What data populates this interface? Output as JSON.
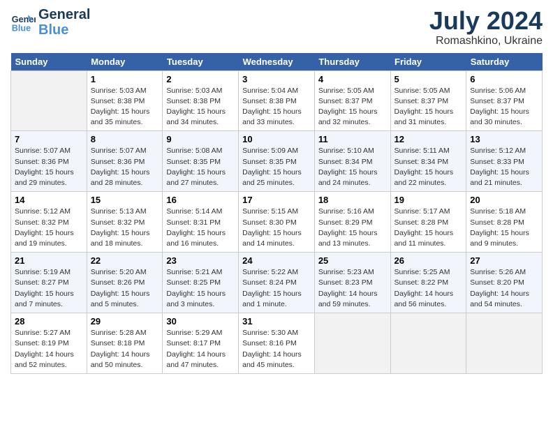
{
  "header": {
    "logo_line1": "General",
    "logo_line2": "Blue",
    "month_year": "July 2024",
    "location": "Romashkino, Ukraine"
  },
  "days_of_week": [
    "Sunday",
    "Monday",
    "Tuesday",
    "Wednesday",
    "Thursday",
    "Friday",
    "Saturday"
  ],
  "weeks": [
    [
      {
        "day": "",
        "info": ""
      },
      {
        "day": "1",
        "info": "Sunrise: 5:03 AM\nSunset: 8:38 PM\nDaylight: 15 hours\nand 35 minutes."
      },
      {
        "day": "2",
        "info": "Sunrise: 5:03 AM\nSunset: 8:38 PM\nDaylight: 15 hours\nand 34 minutes."
      },
      {
        "day": "3",
        "info": "Sunrise: 5:04 AM\nSunset: 8:38 PM\nDaylight: 15 hours\nand 33 minutes."
      },
      {
        "day": "4",
        "info": "Sunrise: 5:05 AM\nSunset: 8:37 PM\nDaylight: 15 hours\nand 32 minutes."
      },
      {
        "day": "5",
        "info": "Sunrise: 5:05 AM\nSunset: 8:37 PM\nDaylight: 15 hours\nand 31 minutes."
      },
      {
        "day": "6",
        "info": "Sunrise: 5:06 AM\nSunset: 8:37 PM\nDaylight: 15 hours\nand 30 minutes."
      }
    ],
    [
      {
        "day": "7",
        "info": "Sunrise: 5:07 AM\nSunset: 8:36 PM\nDaylight: 15 hours\nand 29 minutes."
      },
      {
        "day": "8",
        "info": "Sunrise: 5:07 AM\nSunset: 8:36 PM\nDaylight: 15 hours\nand 28 minutes."
      },
      {
        "day": "9",
        "info": "Sunrise: 5:08 AM\nSunset: 8:35 PM\nDaylight: 15 hours\nand 27 minutes."
      },
      {
        "day": "10",
        "info": "Sunrise: 5:09 AM\nSunset: 8:35 PM\nDaylight: 15 hours\nand 25 minutes."
      },
      {
        "day": "11",
        "info": "Sunrise: 5:10 AM\nSunset: 8:34 PM\nDaylight: 15 hours\nand 24 minutes."
      },
      {
        "day": "12",
        "info": "Sunrise: 5:11 AM\nSunset: 8:34 PM\nDaylight: 15 hours\nand 22 minutes."
      },
      {
        "day": "13",
        "info": "Sunrise: 5:12 AM\nSunset: 8:33 PM\nDaylight: 15 hours\nand 21 minutes."
      }
    ],
    [
      {
        "day": "14",
        "info": "Sunrise: 5:12 AM\nSunset: 8:32 PM\nDaylight: 15 hours\nand 19 minutes."
      },
      {
        "day": "15",
        "info": "Sunrise: 5:13 AM\nSunset: 8:32 PM\nDaylight: 15 hours\nand 18 minutes."
      },
      {
        "day": "16",
        "info": "Sunrise: 5:14 AM\nSunset: 8:31 PM\nDaylight: 15 hours\nand 16 minutes."
      },
      {
        "day": "17",
        "info": "Sunrise: 5:15 AM\nSunset: 8:30 PM\nDaylight: 15 hours\nand 14 minutes."
      },
      {
        "day": "18",
        "info": "Sunrise: 5:16 AM\nSunset: 8:29 PM\nDaylight: 15 hours\nand 13 minutes."
      },
      {
        "day": "19",
        "info": "Sunrise: 5:17 AM\nSunset: 8:28 PM\nDaylight: 15 hours\nand 11 minutes."
      },
      {
        "day": "20",
        "info": "Sunrise: 5:18 AM\nSunset: 8:28 PM\nDaylight: 15 hours\nand 9 minutes."
      }
    ],
    [
      {
        "day": "21",
        "info": "Sunrise: 5:19 AM\nSunset: 8:27 PM\nDaylight: 15 hours\nand 7 minutes."
      },
      {
        "day": "22",
        "info": "Sunrise: 5:20 AM\nSunset: 8:26 PM\nDaylight: 15 hours\nand 5 minutes."
      },
      {
        "day": "23",
        "info": "Sunrise: 5:21 AM\nSunset: 8:25 PM\nDaylight: 15 hours\nand 3 minutes."
      },
      {
        "day": "24",
        "info": "Sunrise: 5:22 AM\nSunset: 8:24 PM\nDaylight: 15 hours\nand 1 minute."
      },
      {
        "day": "25",
        "info": "Sunrise: 5:23 AM\nSunset: 8:23 PM\nDaylight: 14 hours\nand 59 minutes."
      },
      {
        "day": "26",
        "info": "Sunrise: 5:25 AM\nSunset: 8:22 PM\nDaylight: 14 hours\nand 56 minutes."
      },
      {
        "day": "27",
        "info": "Sunrise: 5:26 AM\nSunset: 8:20 PM\nDaylight: 14 hours\nand 54 minutes."
      }
    ],
    [
      {
        "day": "28",
        "info": "Sunrise: 5:27 AM\nSunset: 8:19 PM\nDaylight: 14 hours\nand 52 minutes."
      },
      {
        "day": "29",
        "info": "Sunrise: 5:28 AM\nSunset: 8:18 PM\nDaylight: 14 hours\nand 50 minutes."
      },
      {
        "day": "30",
        "info": "Sunrise: 5:29 AM\nSunset: 8:17 PM\nDaylight: 14 hours\nand 47 minutes."
      },
      {
        "day": "31",
        "info": "Sunrise: 5:30 AM\nSunset: 8:16 PM\nDaylight: 14 hours\nand 45 minutes."
      },
      {
        "day": "",
        "info": ""
      },
      {
        "day": "",
        "info": ""
      },
      {
        "day": "",
        "info": ""
      }
    ]
  ]
}
